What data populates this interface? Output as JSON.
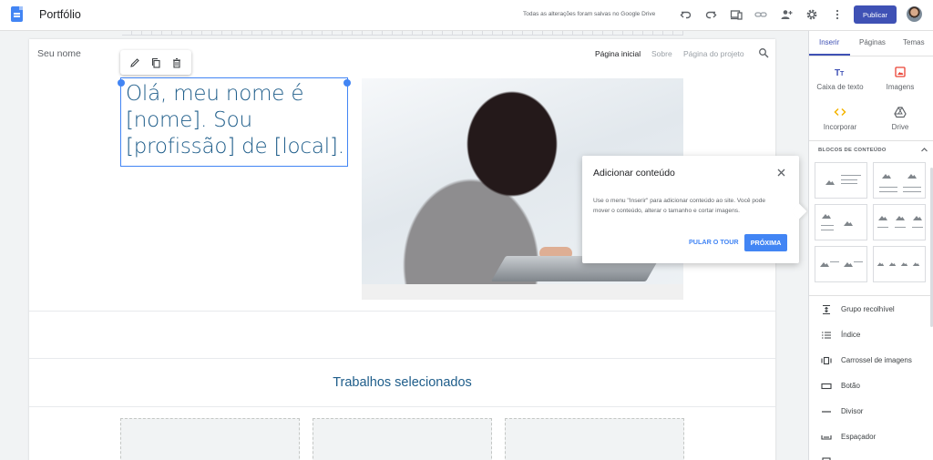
{
  "app": {
    "title": "Portfólio",
    "save_status": "Todas as alterações foram salvas no Google Drive",
    "publish_label": "Publicar"
  },
  "site": {
    "name": "Seu nome",
    "nav": [
      "Página inicial",
      "Sobre",
      "Página do projeto"
    ],
    "heading": "Olá, meu nome é [nome]. Sou [profissão] de [local].",
    "section_title": "Trabalhos selecionados"
  },
  "tour": {
    "title": "Adicionar conteúdo",
    "body": "Use o menu \"Inserir\" para adicionar conteúdo ao site. Você pode mover o conteúdo, alterar o tamanho e cortar imagens.",
    "skip_label": "PULAR O TOUR",
    "next_label": "PRÓXIMA"
  },
  "panel": {
    "tabs": [
      "Inserir",
      "Páginas",
      "Temas"
    ],
    "tools": [
      {
        "label": "Caixa de texto",
        "icon": "text-box-icon"
      },
      {
        "label": "Imagens",
        "icon": "image-icon"
      },
      {
        "label": "Incorporar",
        "icon": "embed-icon"
      },
      {
        "label": "Drive",
        "icon": "drive-icon"
      }
    ],
    "blocks_label": "BLOCOS DE CONTEÚDO",
    "components": [
      {
        "label": "Grupo recolhível",
        "icon": "collapsible-icon"
      },
      {
        "label": "Índice",
        "icon": "toc-icon"
      },
      {
        "label": "Carrossel de imagens",
        "icon": "carousel-icon"
      },
      {
        "label": "Botão",
        "icon": "button-icon"
      },
      {
        "label": "Divisor",
        "icon": "divider-icon"
      },
      {
        "label": "Espaçador",
        "icon": "spacer-icon"
      }
    ]
  },
  "colors": {
    "accent": "#3f51b5",
    "link_blue": "#4285f4",
    "heading_blue": "#1e5d8a"
  }
}
